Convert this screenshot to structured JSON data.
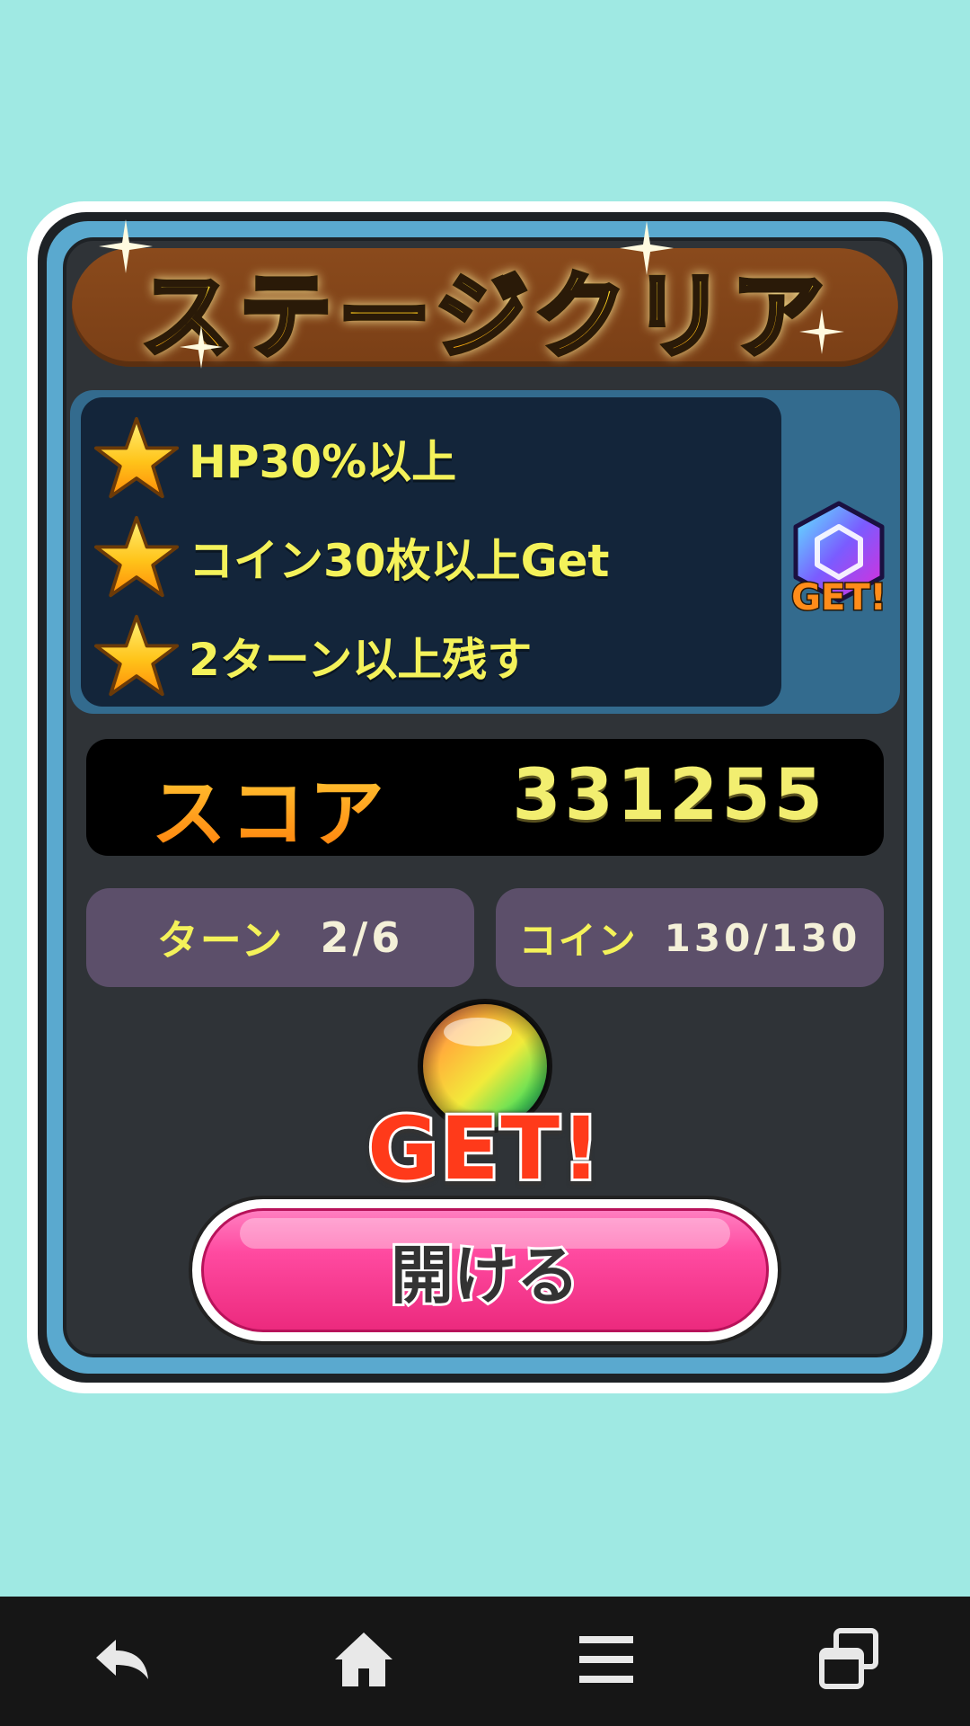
{
  "title": "ステージクリア",
  "missions": [
    {
      "label": "HP30%以上",
      "achieved": true
    },
    {
      "label": "コイン30枚以上Get",
      "achieved": true
    },
    {
      "label": "2ターン以上残す",
      "achieved": true
    }
  ],
  "mission_reward": {
    "icon": "hex-gem-icon",
    "label": "GET!"
  },
  "score": {
    "label": "スコア",
    "value": "331255"
  },
  "stats": {
    "turn": {
      "label": "ターン",
      "value": "2/6"
    },
    "coin": {
      "label": "コイン",
      "value": "130/130"
    }
  },
  "reward": {
    "icon": "rainbow-orb-icon",
    "label": "GET!"
  },
  "open_button": {
    "label": "開ける"
  },
  "nav": {
    "items": [
      {
        "icon": "back-icon"
      },
      {
        "icon": "home-icon"
      },
      {
        "icon": "menu-icon"
      },
      {
        "icon": "recent-apps-icon"
      }
    ]
  },
  "colors": {
    "background": "#9fe9e3",
    "panel": "#2f3337",
    "mission_text": "#f4f25a",
    "button_pink": "#ff4aa0",
    "title_gold": "#ffc21a"
  }
}
